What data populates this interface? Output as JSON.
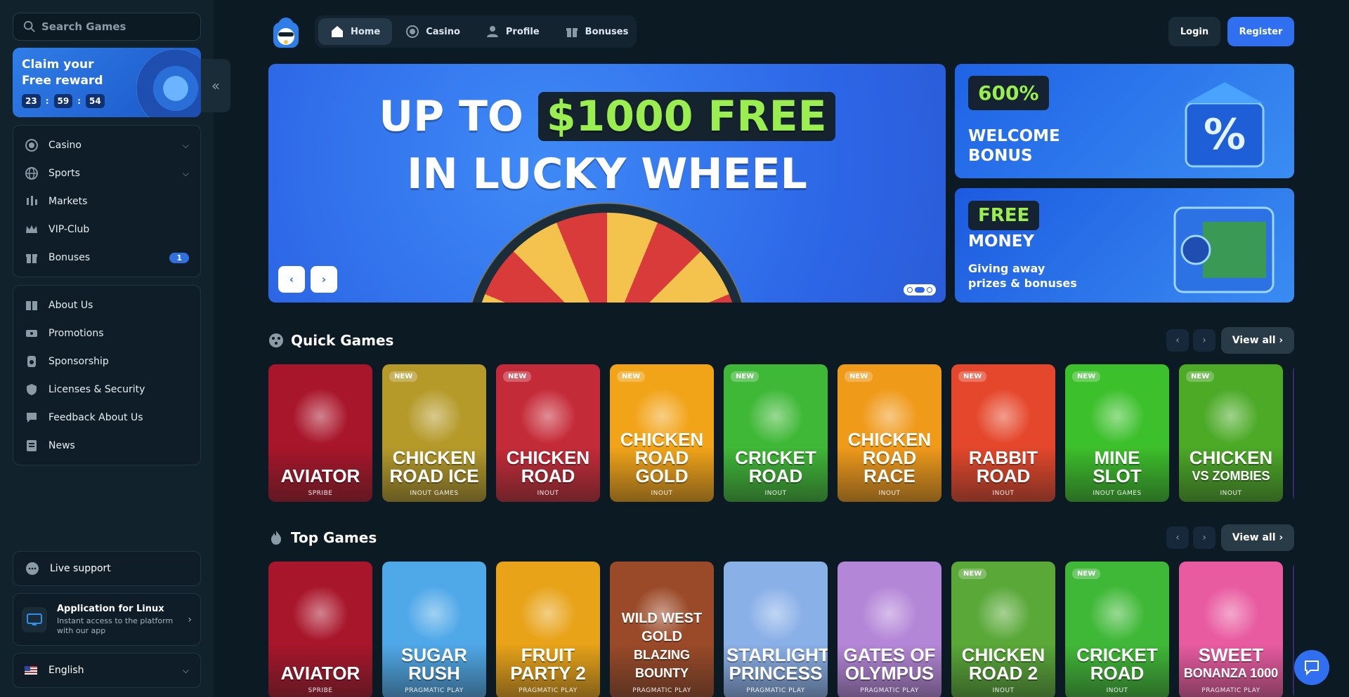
{
  "search": {
    "placeholder": "Search Games"
  },
  "reward": {
    "title": "Claim your Free reward",
    "timer": [
      "23",
      "59",
      "54"
    ]
  },
  "sidebar": {
    "main_items": [
      {
        "label": "Casino",
        "icon": "casino-chip-icon",
        "expand": true
      },
      {
        "label": "Sports",
        "icon": "globe-icon",
        "expand": true
      },
      {
        "label": "Markets",
        "icon": "candles-icon"
      },
      {
        "label": "VIP-Club",
        "icon": "crown-icon"
      },
      {
        "label": "Bonuses",
        "icon": "gift-icon",
        "badge": "1"
      }
    ],
    "info_items": [
      {
        "label": "About Us",
        "icon": "book-icon"
      },
      {
        "label": "Promotions",
        "icon": "ticket-icon"
      },
      {
        "label": "Sponsorship",
        "icon": "medal-icon"
      },
      {
        "label": "Licenses & Security",
        "icon": "shield-icon"
      },
      {
        "label": "Feedback About Us",
        "icon": "chat-icon"
      },
      {
        "label": "News",
        "icon": "newspaper-icon"
      }
    ],
    "support": "Live support",
    "app": {
      "title": "Application for Linux",
      "subtitle": "Instant access to the platform with our app"
    },
    "language": "English"
  },
  "topnav": {
    "tabs": [
      {
        "label": "Home",
        "icon": "home-icon",
        "active": true
      },
      {
        "label": "Casino",
        "icon": "casino-chip-icon"
      },
      {
        "label": "Profile",
        "icon": "user-icon"
      },
      {
        "label": "Bonuses",
        "icon": "gift-icon"
      }
    ],
    "login": "Login",
    "register": "Register"
  },
  "hero": {
    "line1_prefix": "UP TO",
    "line1_highlight": "$1000 FREE",
    "line2": "IN LUCKY WHEEL"
  },
  "promos": [
    {
      "tag": "600%",
      "title_l1": "WELCOME",
      "title_l2": "BONUS"
    },
    {
      "tag": "FREE",
      "title_l1": "MONEY",
      "subtitle_l1": "Giving away",
      "subtitle_l2": "prizes & bonuses"
    }
  ],
  "quick_games": {
    "title": "Quick Games",
    "view_all": "View all",
    "cards": [
      {
        "l1": "",
        "l2": "AVIATOR",
        "provider": "SPRIBE",
        "new": false,
        "bg": "#a8162b"
      },
      {
        "l1": "CHICKEN",
        "l2": "ROAD ICE",
        "provider": "INOUT GAMES",
        "new": true,
        "bg": "#b59a2a"
      },
      {
        "l1": "CHICKEN",
        "l2": "ROAD",
        "provider": "INOUT",
        "new": true,
        "bg": "#c42b38"
      },
      {
        "l1": "CHICKEN",
        "l2": "ROAD GOLD",
        "provider": "INOUT",
        "new": true,
        "bg": "#f2a418"
      },
      {
        "l1": "CRICKET",
        "l2": "ROAD",
        "provider": "INOUT",
        "new": true,
        "bg": "#3fb837"
      },
      {
        "l1": "CHICKEN",
        "l2": "ROAD RACE",
        "provider": "INOUT",
        "new": true,
        "bg": "#f09a1a"
      },
      {
        "l1": "RABBIT",
        "l2": "ROAD",
        "provider": "INOUT",
        "new": true,
        "bg": "#e4472b"
      },
      {
        "l1": "MINE",
        "l2": "SLOT",
        "provider": "INOUT GAMES",
        "new": true,
        "bg": "#3cc02b"
      },
      {
        "l1": "CHICKEN",
        "l2": "VS ZOMBIES",
        "provider": "INOUT",
        "new": true,
        "bg": "#4caa27"
      }
    ]
  },
  "top_games": {
    "title": "Top Games",
    "view_all": "View all",
    "cards": [
      {
        "l1": "",
        "l2": "AVIATOR",
        "provider": "SPRIBE",
        "new": false,
        "bg": "#a8162b"
      },
      {
        "l1": "SUGAR",
        "l2": "RUSH",
        "provider": "PRAGMATIC PLAY",
        "new": false,
        "bg": "#4fa8e8"
      },
      {
        "l1": "FRUIT",
        "l2": "PARTY 2",
        "provider": "PRAGMATIC PLAY",
        "new": false,
        "bg": "#e8a318"
      },
      {
        "l1": "WILD WEST GOLD",
        "l2": "BLAZING BOUNTY",
        "provider": "PRAGMATIC PLAY",
        "new": false,
        "bg": "#9a4a28"
      },
      {
        "l1": "STARLIGHT",
        "l2": "PRINCESS",
        "provider": "PRAGMATIC PLAY",
        "new": false,
        "bg": "#8ab0e8"
      },
      {
        "l1": "GATES OF",
        "l2": "OLYMPUS",
        "provider": "PRAGMATIC PLAY",
        "new": false,
        "bg": "#b486d8"
      },
      {
        "l1": "CHICKEN",
        "l2": "ROAD 2",
        "provider": "INOUT",
        "new": true,
        "bg": "#59a838"
      },
      {
        "l1": "CRICKET",
        "l2": "ROAD",
        "provider": "INOUT",
        "new": true,
        "bg": "#3fb837"
      },
      {
        "l1": "SWEET",
        "l2": "BONANZA 1000",
        "provider": "PRAGMATIC PLAY",
        "new": false,
        "bg": "#e85ba0"
      }
    ]
  },
  "colors": {
    "accent": "#2f6ff0",
    "lime": "#9bee4f",
    "background": "#0c1a24"
  }
}
